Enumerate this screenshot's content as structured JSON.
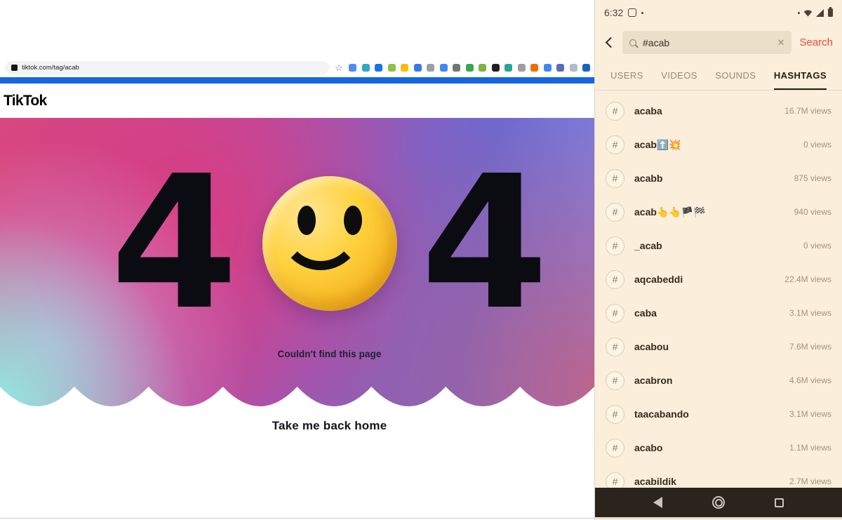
{
  "browser": {
    "toolbar": {
      "url": "tiktok.com/tag/acab",
      "star_icon": "☆",
      "extensions": [
        {
          "color": "#4d8bf8"
        },
        {
          "color": "#31a8c4"
        },
        {
          "color": "#1a73e8"
        },
        {
          "color": "#8bc34a"
        },
        {
          "color": "#fbbc04"
        },
        {
          "color": "#3b78e7"
        },
        {
          "color": "#9aa0a6"
        },
        {
          "color": "#4285f4"
        },
        {
          "color": "#757575"
        },
        {
          "color": "#34a853"
        },
        {
          "color": "#7cb342"
        },
        {
          "color": "#202124"
        },
        {
          "color": "#26a69a"
        },
        {
          "color": "#9e9e9e"
        },
        {
          "color": "#ef6c00"
        },
        {
          "color": "#4285f4"
        },
        {
          "color": "#5c6bc0"
        },
        {
          "color": "#b0bec5"
        },
        {
          "color": "#1565c0"
        }
      ]
    },
    "logo": "TikTok",
    "page": {
      "four": "4",
      "not_found": "Couldn't find this page",
      "back_home": "Take me back home"
    }
  },
  "phone": {
    "status_time": "6:32",
    "hash_symbol": "#",
    "search": {
      "value": "#acab",
      "clear_icon": "✕",
      "button": "Search"
    },
    "tabs": [
      {
        "label": "USERS",
        "active": false
      },
      {
        "label": "VIDEOS",
        "active": false
      },
      {
        "label": "SOUNDS",
        "active": false
      },
      {
        "label": "HASHTAGS",
        "active": true
      }
    ],
    "results": [
      {
        "name": "acaba",
        "views": "16.7M views"
      },
      {
        "name": "acab⬆️💥",
        "views": "0 views"
      },
      {
        "name": "acabb",
        "views": "875 views"
      },
      {
        "name": "acab👆👆🏴🏁",
        "views": "940 views"
      },
      {
        "name": "_acab",
        "views": "0 views"
      },
      {
        "name": "aqcabeddi",
        "views": "22.4M views"
      },
      {
        "name": "caba",
        "views": "3.1M views"
      },
      {
        "name": "acabou",
        "views": "7.6M views"
      },
      {
        "name": "acabron",
        "views": "4.6M views"
      },
      {
        "name": "taacabando",
        "views": "3.1M views"
      },
      {
        "name": "acabo",
        "views": "1.1M views"
      },
      {
        "name": "acabildik",
        "views": "2.7M views"
      }
    ]
  }
}
